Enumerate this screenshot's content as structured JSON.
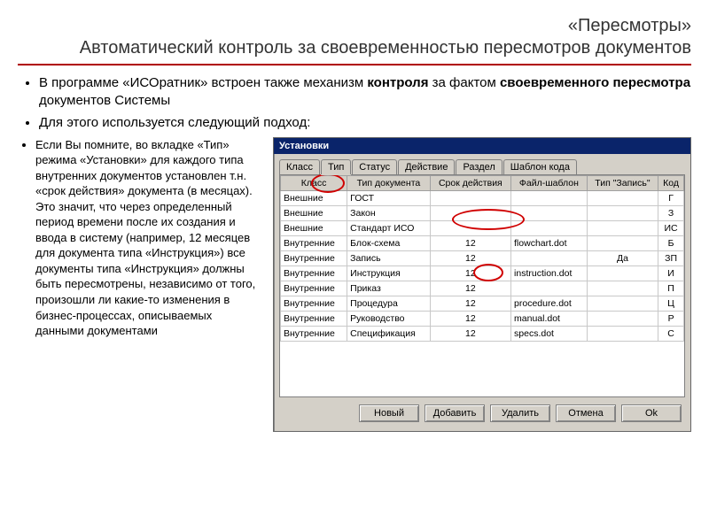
{
  "header": {
    "supertitle": "«Пересмотры»",
    "title": "Автоматический контроль за своевременностью пересмотров документов"
  },
  "intro_bullets": [
    {
      "pre": "В программе «ИСОратник» встроен также механизм ",
      "b1": "контроля",
      "mid": " за фактом ",
      "b2": "своевременного пересмотра",
      "post": " документов Системы"
    },
    {
      "text": "Для этого используется следующий подход:"
    }
  ],
  "left_bullet": "Если Вы помните, во вкладке «Тип» режима «Установки» для каждого типа внутренних документов установлен т.н. «срок действия» документа (в месяцах). Это значит, что через определенный период времени после их создания и ввода в систему (например, 12 месяцев для документа типа «Инструкция») все документы типа «Инструкция» должны быть пересмотрены, независимо от того, произошли ли какие-то изменения в бизнес-процессах, описываемых данными документами",
  "dialog": {
    "title": "Установки",
    "tabs": [
      "Класс",
      "Тип",
      "Статус",
      "Действие",
      "Раздел",
      "Шаблон кода"
    ],
    "active_tab": 1,
    "columns": [
      "Класс",
      "Тип документа",
      "Срок действия",
      "Файл-шаблон",
      "Тип \"Запись\"",
      "Код"
    ],
    "rows": [
      {
        "class": "Внешние",
        "type": "ГОСТ",
        "term": "",
        "file": "",
        "rec": "",
        "code": "Г"
      },
      {
        "class": "Внешние",
        "type": "Закон",
        "term": "",
        "file": "",
        "rec": "",
        "code": "З"
      },
      {
        "class": "Внешние",
        "type": "Стандарт ИСО",
        "term": "",
        "file": "",
        "rec": "",
        "code": "ИС"
      },
      {
        "class": "Внутренние",
        "type": "Блок-схема",
        "term": "12",
        "file": "flowchart.dot",
        "rec": "",
        "code": "Б"
      },
      {
        "class": "Внутренние",
        "type": "Запись",
        "term": "12",
        "file": "",
        "rec": "Да",
        "code": "ЗП"
      },
      {
        "class": "Внутренние",
        "type": "Инструкция",
        "term": "12",
        "file": "instruction.dot",
        "rec": "",
        "code": "И"
      },
      {
        "class": "Внутренние",
        "type": "Приказ",
        "term": "12",
        "file": "",
        "rec": "",
        "code": "П"
      },
      {
        "class": "Внутренние",
        "type": "Процедура",
        "term": "12",
        "file": "procedure.dot",
        "rec": "",
        "code": "Ц"
      },
      {
        "class": "Внутренние",
        "type": "Руководство",
        "term": "12",
        "file": "manual.dot",
        "rec": "",
        "code": "Р"
      },
      {
        "class": "Внутренние",
        "type": "Спецификация",
        "term": "12",
        "file": "specs.dot",
        "rec": "",
        "code": "С"
      }
    ],
    "buttons": {
      "new": "Новый",
      "add": "Добавить",
      "delete": "Удалить",
      "cancel": "Отмена",
      "ok": "Ok"
    }
  }
}
